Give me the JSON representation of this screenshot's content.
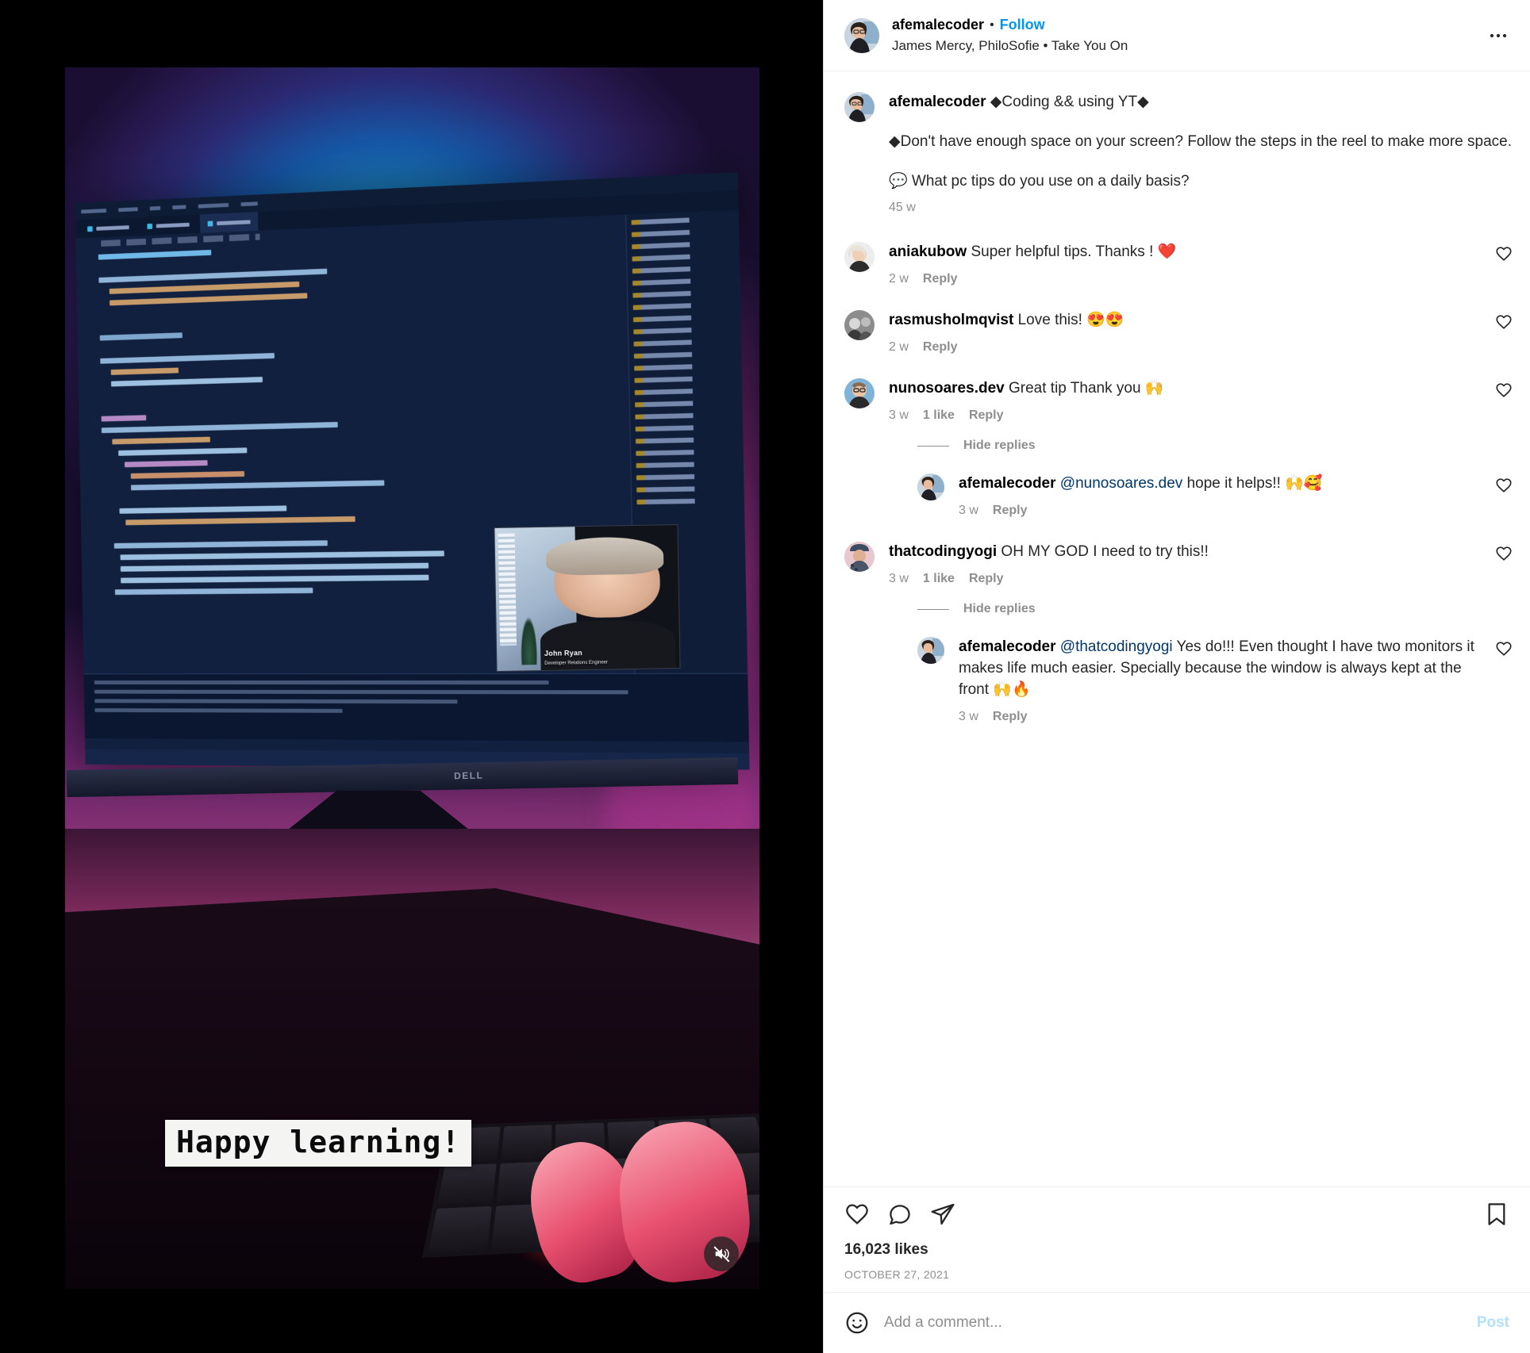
{
  "post": {
    "header": {
      "username": "afemalecoder",
      "separator": "•",
      "follow_label": "Follow",
      "audio_attribution": "James Mercy, PhiloSofie • Take You On",
      "more_options_icon": "more-options-icon"
    },
    "caption": {
      "username": "afemalecoder",
      "title": "◆Coding && using YT◆",
      "paragraph_1": "◆Don't have enough space on your screen? Follow the steps in the reel to make more space.",
      "paragraph_2": "💬 What pc tips do you use on a daily basis?",
      "time": "45 w"
    },
    "comments": [
      {
        "username": "aniakubow",
        "text": " Super helpful tips. Thanks ! ❤️",
        "time": "2 w",
        "likes": "",
        "reply_label": "Reply",
        "replies": []
      },
      {
        "username": "rasmusholmqvist",
        "text": " Love this! 😍😍",
        "time": "2 w",
        "likes": "",
        "reply_label": "Reply",
        "replies": []
      },
      {
        "username": "nunosoares.dev",
        "text": " Great tip Thank you 🙌",
        "time": "3 w",
        "likes": "1 like",
        "reply_label": "Reply",
        "hide_replies_label": "Hide replies",
        "replies": [
          {
            "username": "afemalecoder",
            "mention": "@nunosoares.dev",
            "text": " hope it helps!! 🙌🥰",
            "time": "3 w",
            "reply_label": "Reply"
          }
        ]
      },
      {
        "username": "thatcodingyogi",
        "text": " OH MY GOD I need to try this!!",
        "time": "3 w",
        "likes": "1 like",
        "reply_label": "Reply",
        "hide_replies_label": "Hide replies",
        "replies": [
          {
            "username": "afemalecoder",
            "mention": "@thatcodingyogi",
            "text": " Yes do!!! Even thought I have two monitors it makes life much easier. Specially because the window is always kept at the front 🙌🔥",
            "time": "3 w",
            "reply_label": "Reply"
          }
        ]
      }
    ],
    "actions": {
      "like_icon": "heart-icon",
      "comment_icon": "comment-icon",
      "share_icon": "share-icon",
      "save_icon": "bookmark-icon",
      "likes_count": "16,023 likes",
      "posted_date": "OCTOBER 27, 2021"
    },
    "add_comment": {
      "emoji_icon": "emoji-icon",
      "placeholder": "Add a comment...",
      "value": "",
      "post_label": "Post"
    }
  },
  "media": {
    "type": "reel-video",
    "overlay_caption": "Happy learning!",
    "mute_icon": "speaker-muted-icon",
    "monitor_brand": "DELL",
    "pip": {
      "name": "John Ryan",
      "role": "Developer Relations Engineer"
    }
  },
  "colors": {
    "accent_blue": "#0095f6",
    "mention_blue": "#00376b",
    "muted_gray": "#8e8e8e",
    "text_dark": "#262626",
    "post_disabled": "#b2dffc"
  }
}
